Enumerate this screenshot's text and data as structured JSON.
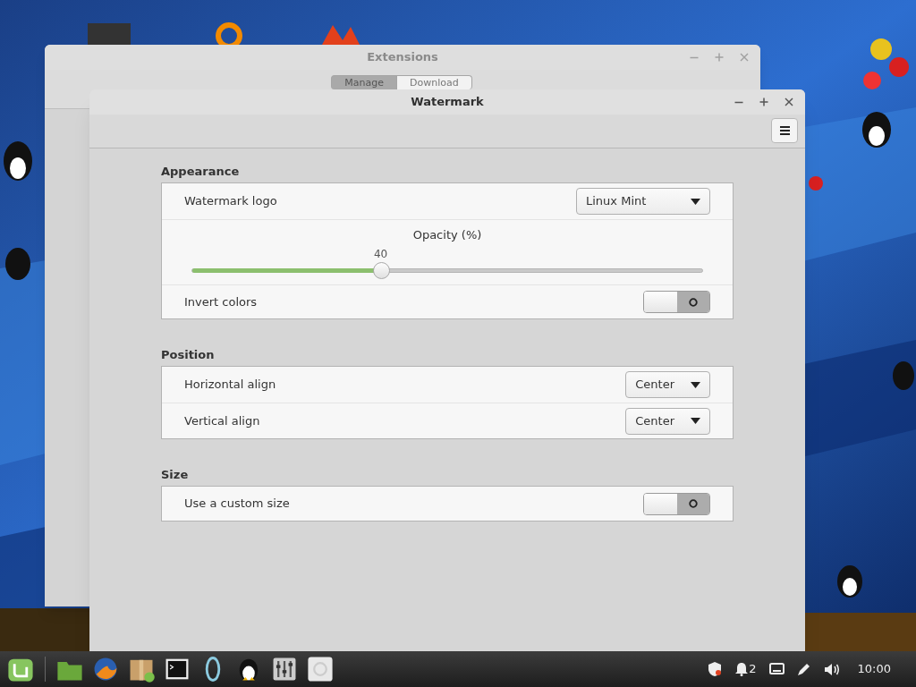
{
  "extensions_window": {
    "title": "Extensions",
    "tabs": [
      {
        "label": "Manage",
        "selected": true
      },
      {
        "label": "Download",
        "selected": false
      }
    ]
  },
  "window": {
    "title": "Watermark"
  },
  "sections": [
    {
      "title": "Appearance",
      "rows": [
        {
          "kind": "dropdown",
          "label": "Watermark logo",
          "value": "Linux Mint"
        },
        {
          "kind": "slider",
          "label": "Opacity (%)",
          "reading": "40",
          "level": 0.37
        },
        {
          "kind": "switch",
          "label": "Invert colors",
          "on": false
        }
      ]
    },
    {
      "title": "Position",
      "rows": [
        {
          "kind": "dropdown",
          "label": "Horizontal align",
          "value": "Center"
        },
        {
          "kind": "dropdown",
          "label": "Vertical align",
          "value": "Center"
        }
      ]
    },
    {
      "title": "Size",
      "rows": [
        {
          "kind": "switch",
          "label": "Use a custom size",
          "on": false
        }
      ]
    }
  ],
  "taskbar": {
    "notification_count": "2",
    "clock": "10:00"
  }
}
